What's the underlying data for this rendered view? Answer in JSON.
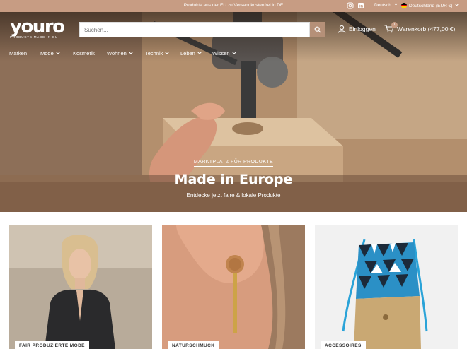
{
  "topbar": {
    "promo": "Produkte aus der EU zu Versandkostenfrei in DE",
    "language": "Deutsch",
    "country": "Deutschland (EUR €)"
  },
  "header": {
    "logo_text": "youro",
    "logo_tagline": "PRODUCTS MADE IN EU",
    "search_placeholder": "Suchen...",
    "login_label": "Einloggen",
    "cart_label": "Warenkorb (477,00 €)",
    "cart_count": "1"
  },
  "nav": {
    "items": [
      {
        "label": "Marken",
        "dropdown": false
      },
      {
        "label": "Mode",
        "dropdown": true
      },
      {
        "label": "Kosmetik",
        "dropdown": false
      },
      {
        "label": "Wohnen",
        "dropdown": true
      },
      {
        "label": "Technik",
        "dropdown": true
      },
      {
        "label": "Leben",
        "dropdown": true
      },
      {
        "label": "Wissen",
        "dropdown": true
      }
    ]
  },
  "hero": {
    "tag": "MARKTPLATZ FÜR PRODUKTE",
    "title": "Made in Europe",
    "subtitle": "Entdecke jetzt faire & lokale Produkte"
  },
  "categories": [
    {
      "label": "FAIR PRODUZIERTE MODE"
    },
    {
      "label": "NATURSCHMUCK"
    },
    {
      "label": "ACCESSOIRES"
    }
  ],
  "colors": {
    "accent": "#c79c83",
    "search_button": "#b59078"
  }
}
